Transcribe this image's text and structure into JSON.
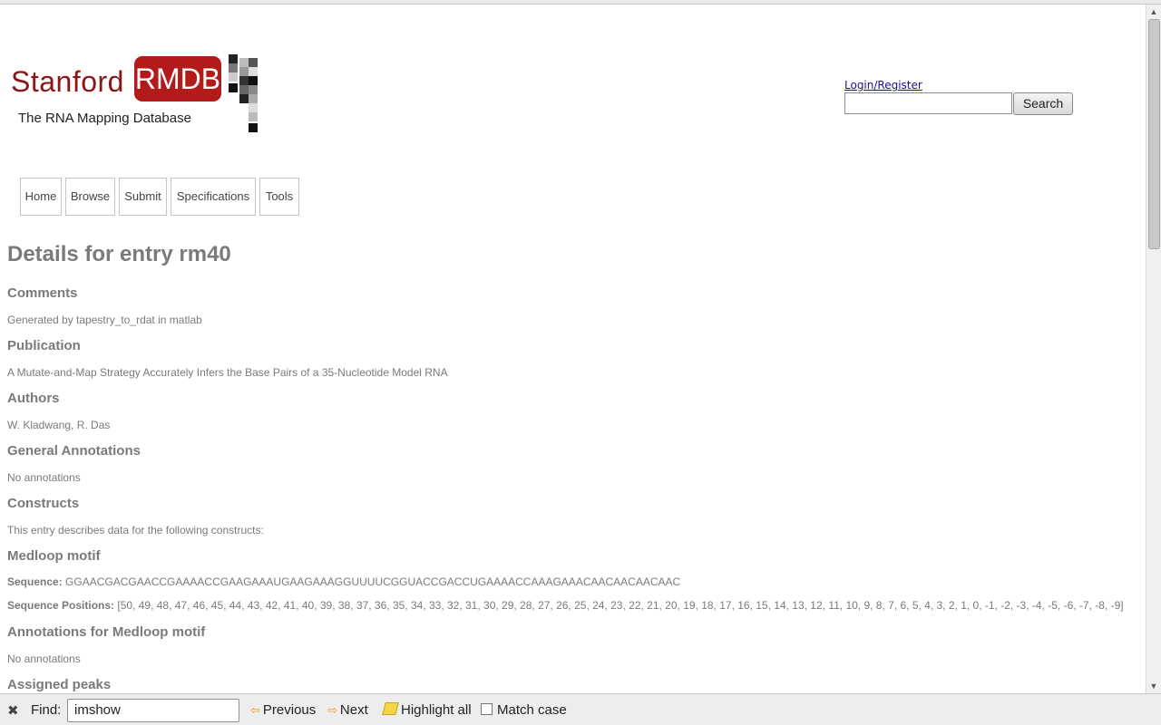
{
  "logo": {
    "stanford": "Stanford",
    "rmdb": "RMDB",
    "subtitle": "The RNA Mapping Database",
    "brand_color": "#b31b1b"
  },
  "header": {
    "login_link": "Login/Register",
    "search_value": "",
    "search_button": "Search"
  },
  "nav": {
    "items": [
      "Home",
      "Browse",
      "Submit",
      "Specifications",
      "Tools"
    ]
  },
  "main": {
    "title": "Details for entry rm40",
    "comments_heading": "Comments",
    "comments_text": "Generated by tapestry_to_rdat in matlab",
    "publication_heading": "Publication",
    "publication_text": "A Mutate-and-Map Strategy Accurately Infers the Base Pairs of a 35-Nucleotide Model RNA",
    "authors_heading": "Authors",
    "authors_text": "W. Kladwang, R. Das",
    "general_annotations_heading": "General Annotations",
    "general_annotations_text": "No annotations",
    "constructs_heading": "Constructs",
    "constructs_text": "This entry describes data for the following constructs:",
    "construct_name": "Medloop motif",
    "sequence_label": "Sequence:",
    "sequence_value": "GGAACGACGAACCGAAAACCGAAGAAAUGAAGAAAGGUUUUCGGUACCGACCUGAAAACCAAAGAAACAACAACAACAAC",
    "positions_label": "Sequence Positions:",
    "positions_value": "[50, 49, 48, 47, 46, 45, 44, 43, 42, 41, 40, 39, 38, 37, 36, 35, 34, 33, 32, 31, 30, 29, 28, 27, 26, 25, 24, 23, 22, 21, 20, 19, 18, 17, 16, 15, 14, 13, 12, 11, 10, 9, 8, 7, 6, 5, 4, 3, 2, 1, 0, -1, -2, -3, -4, -5, -6, -7, -8, -9]",
    "construct_annotations_heading": "Annotations for Medloop motif",
    "construct_annotations_text": "No annotations",
    "assigned_peaks_heading": "Assigned peaks"
  },
  "findbar": {
    "close_icon": "close-icon",
    "find_label": "Find:",
    "find_value": "imshow",
    "previous_label": "Previous",
    "next_label": "Next",
    "highlight_label": "Highlight all",
    "match_case_label": "Match case",
    "match_case_checked": false
  }
}
